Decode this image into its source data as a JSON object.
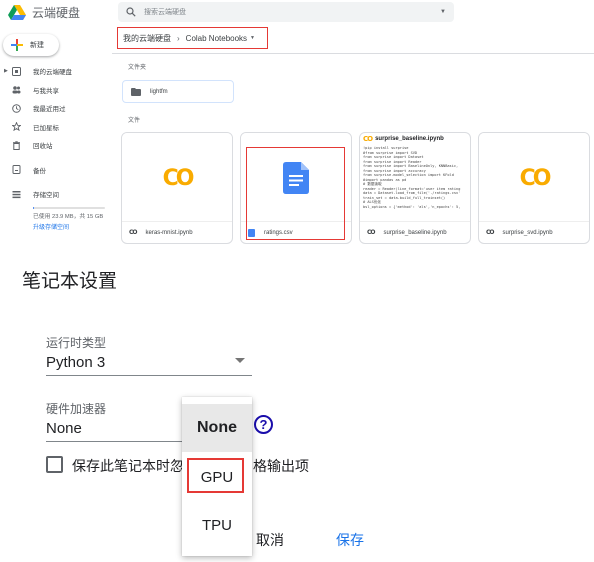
{
  "app": {
    "name": "云端硬盘"
  },
  "search": {
    "placeholder": "搜索云端硬盘"
  },
  "new_button": {
    "label": "新建"
  },
  "sidebar": {
    "items": [
      {
        "label": "我的云端硬盘",
        "icon": "drive-folder-icon"
      },
      {
        "label": "与我共享",
        "icon": "shared-people-icon"
      },
      {
        "label": "我最近用过",
        "icon": "clock-icon"
      },
      {
        "label": "已加星标",
        "icon": "star-icon"
      },
      {
        "label": "回收站",
        "icon": "trash-icon"
      },
      {
        "label": "备份",
        "icon": "backup-icon"
      },
      {
        "label": "存储空间",
        "icon": "storage-icon"
      }
    ],
    "storage": {
      "used_text": "已使用 23.9 MB，共 15 GB",
      "used_fraction": 0.0016,
      "upgrade_link": "升级存储空间"
    }
  },
  "breadcrumb": {
    "root": "我的云端硬盘",
    "current": "Colab Notebooks"
  },
  "sections": {
    "folders": "文件夹",
    "files": "文件"
  },
  "folders": [
    {
      "name": "lightfm"
    }
  ],
  "files": [
    {
      "name": "keras-mnist.ipynb",
      "type": "colab"
    },
    {
      "name": "ratings.csv",
      "type": "doc"
    },
    {
      "name": "surprise_baseline.ipynb",
      "type": "colab-preview"
    },
    {
      "name": "surprise_svd.ipynb",
      "type": "colab"
    }
  ],
  "preview": {
    "title": "surprise_baseline.ipynb",
    "code": "!pip install surprise\n#from surprise import SVD\nfrom surprise import Dataset\nfrom surprise import Reader\nfrom surprise import BaselineOnly, KNNBasic,\nfrom surprise import accuracy\nfrom surprise.model_selection import KFold\n#import pandas as pd\n# 数据读取\nreader = Reader(line_format='user item rating\ndata = Dataset.load_from_file('./ratings.csv'\ntrain_set = data.build_full_trainset()\n# ALS优化\nbsl_options = {'method': 'als','n_epochs': 5,"
  },
  "dialog": {
    "title": "笔记本设置",
    "runtime_label": "运行时类型",
    "runtime_value": "Python 3",
    "accel_label": "硬件加速器",
    "accel_value": "None",
    "help_glyph": "?",
    "checkbox_text_left": "保存此笔记本时忽",
    "checkbox_text_right": "格输出项",
    "cancel": "取消",
    "save": "保存",
    "options": [
      "None",
      "GPU",
      "TPU"
    ]
  },
  "colors": {
    "highlight": "#e53935",
    "accent": "#1a73e8",
    "colab_orange": "#f9ab00"
  }
}
